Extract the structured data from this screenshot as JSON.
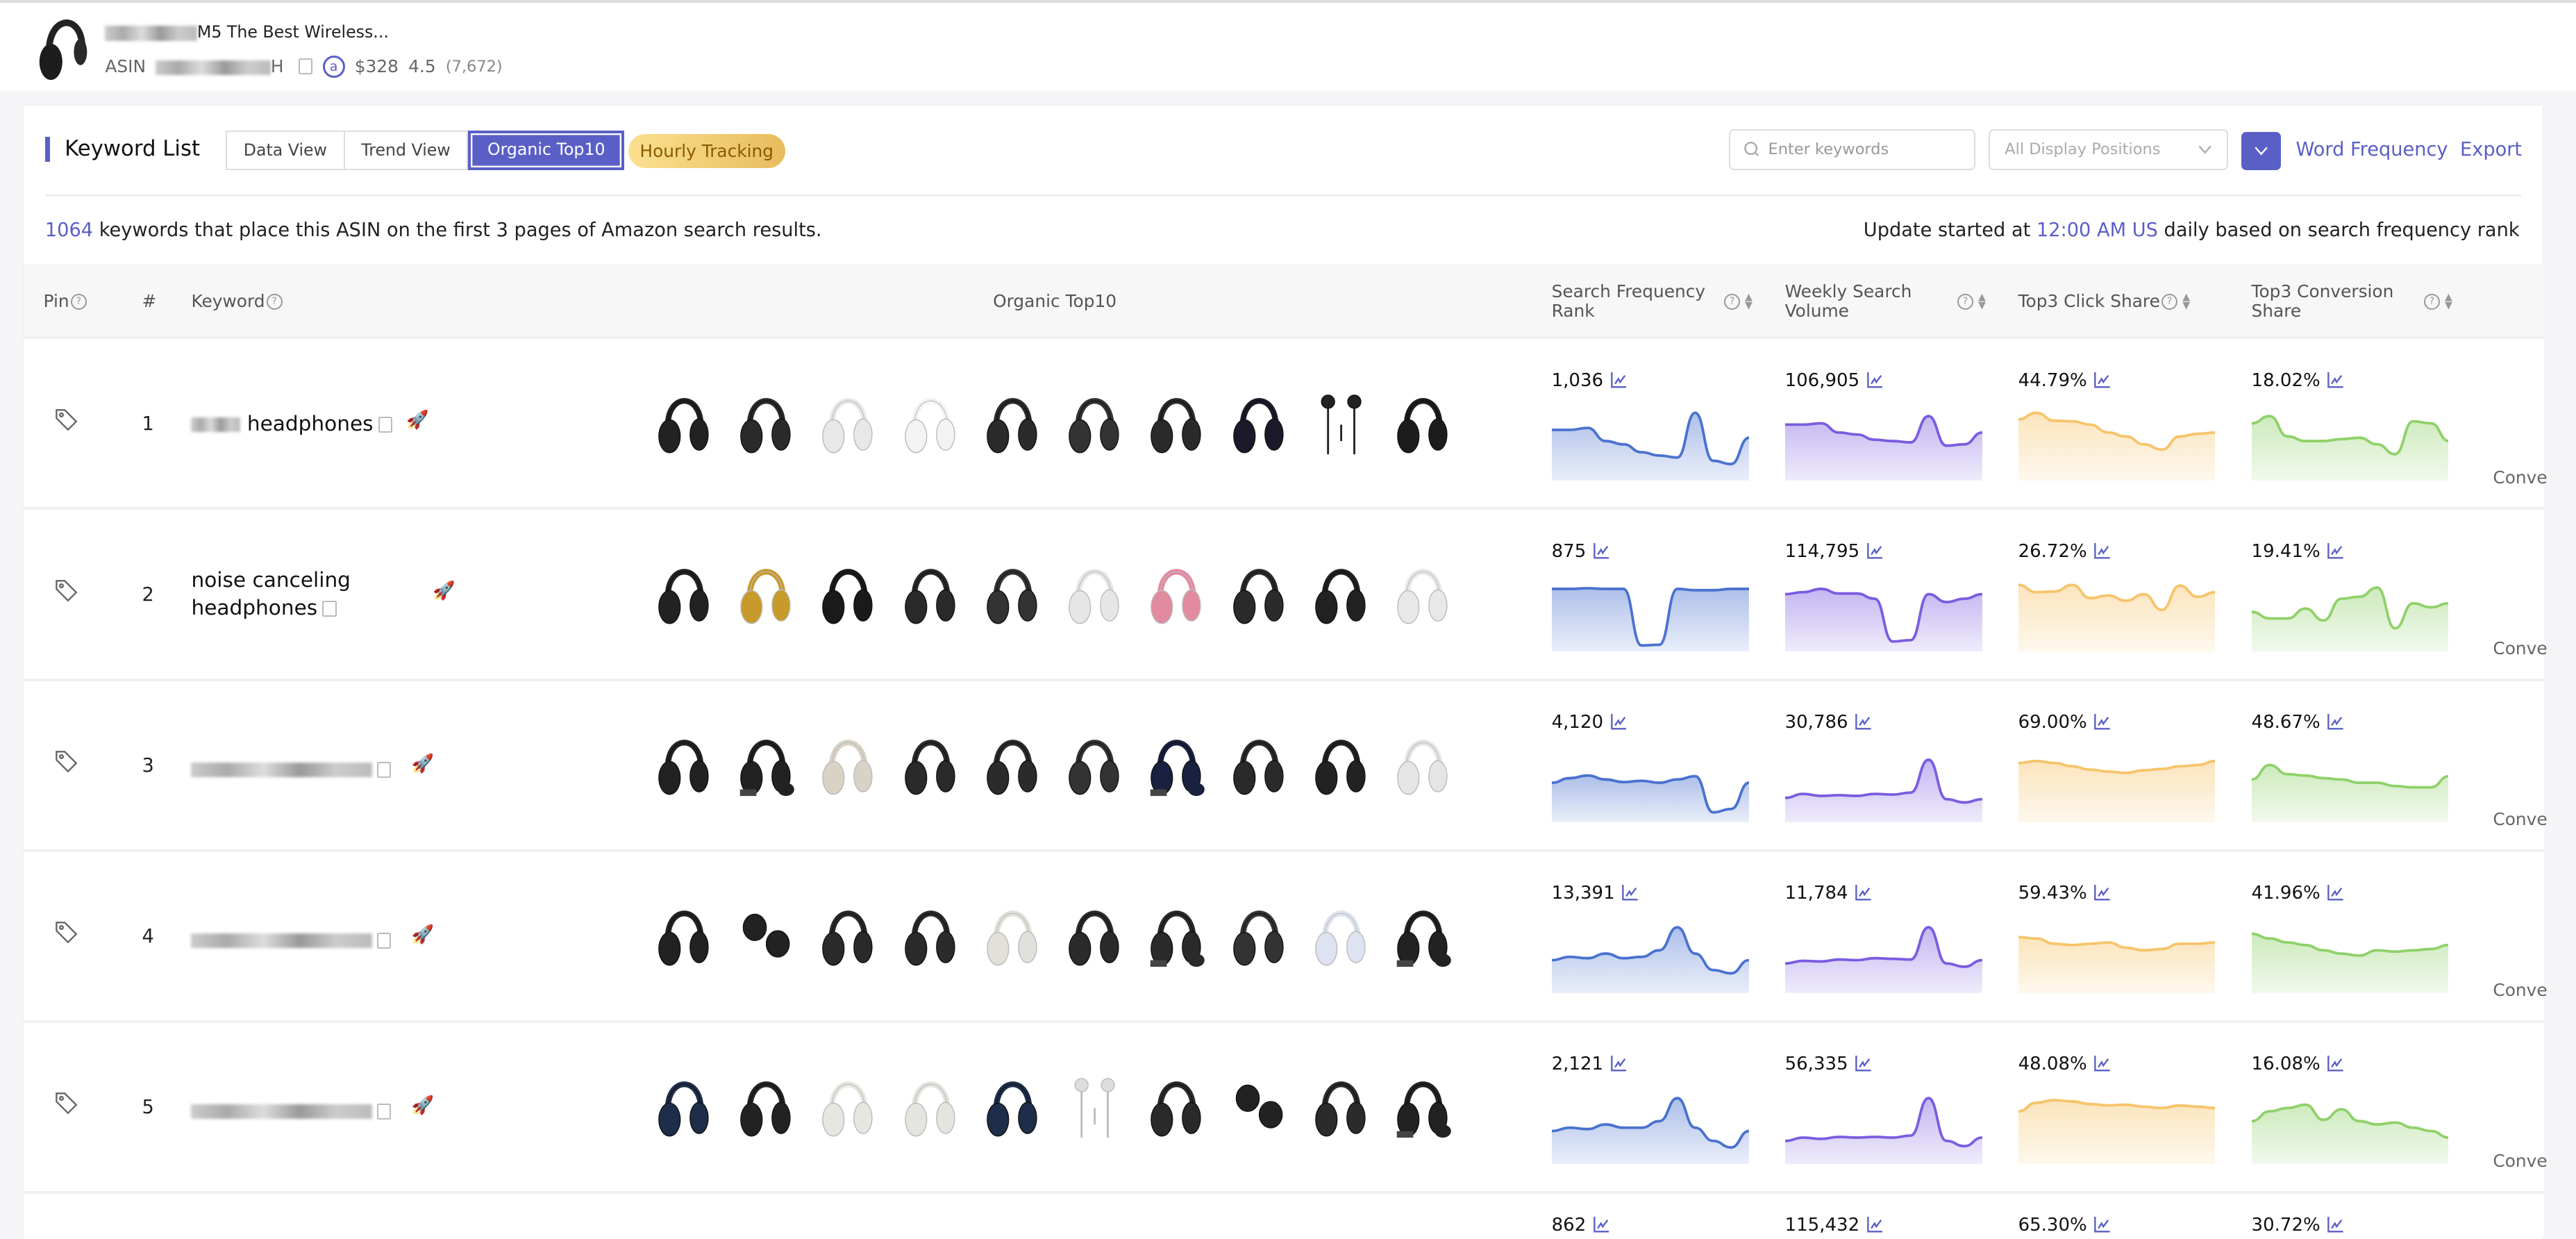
{
  "product": {
    "title_visible": "M5 The Best Wireless...",
    "asin_label": "ASIN",
    "asin_visible_suffix": "H",
    "amazon_icon": "a",
    "price": "$328",
    "rating": "4.5",
    "reviews": "(7,672)"
  },
  "toolbar": {
    "title": "Keyword List",
    "views": [
      {
        "label": "Data View",
        "active": false
      },
      {
        "label": "Trend View",
        "active": false
      },
      {
        "label": "Organic Top10",
        "active": true
      }
    ],
    "hourly_tracking": "Hourly Tracking",
    "search_placeholder": "Enter keywords",
    "position_select": "All Display Positions",
    "word_frequency": "Word Frequency",
    "export": "Export"
  },
  "summary": {
    "count": "1064",
    "text": " keywords that place this ASIN on the first 3 pages of Amazon search results.",
    "update_prefix": "Update started at ",
    "update_time": "12:00 AM US",
    "update_suffix": " daily based on search frequency rank"
  },
  "colors": {
    "accent": "#5a5fc6",
    "sfr": "#4a72cf",
    "volume": "#7b5ce0",
    "click": "#f6c46a",
    "conversion": "#8fd16a"
  },
  "table": {
    "headers": {
      "pin": "Pin",
      "index": "#",
      "keyword": "Keyword",
      "organic": "Organic Top10",
      "sfr": "Search Frequency Rank",
      "volume": "Weekly Search Volume",
      "click": "Top3 Click Share",
      "conversion": "Top3 Conversion Share"
    },
    "overflow_column": "Conve",
    "rows": [
      {
        "index": "1",
        "keyword": "headphones",
        "blurred_prefix": true,
        "blurred": false,
        "sfr": "1,036",
        "volume": "106,905",
        "click": "44.79%",
        "conversion": "18.02%",
        "trends": {
          "sfr": [
            0.72,
            0.72,
            0.75,
            0.55,
            0.5,
            0.38,
            0.33,
            0.3,
            0.98,
            0.25,
            0.2,
            0.6
          ],
          "volume": [
            0.8,
            0.8,
            0.82,
            0.68,
            0.65,
            0.57,
            0.55,
            0.53,
            0.93,
            0.48,
            0.5,
            0.68
          ],
          "click": [
            0.88,
            0.98,
            0.86,
            0.85,
            0.8,
            0.68,
            0.62,
            0.5,
            0.42,
            0.62,
            0.66,
            0.68
          ],
          "conversion": [
            0.82,
            0.93,
            0.62,
            0.55,
            0.55,
            0.58,
            0.6,
            0.5,
            0.35,
            0.85,
            0.82,
            0.55
          ]
        },
        "products": [
          [
            "over-ear",
            "#222"
          ],
          [
            "over-ear",
            "#2a2a2a"
          ],
          [
            "over-ear",
            "#e8e8e8"
          ],
          [
            "over-ear",
            "#f3f3f3"
          ],
          [
            "over-ear",
            "#2b2b2b"
          ],
          [
            "over-ear",
            "#333"
          ],
          [
            "over-ear",
            "#2a2a2a"
          ],
          [
            "over-ear",
            "#1a1a2a"
          ],
          [
            "wired-earbuds",
            "#222"
          ],
          [
            "over-ear",
            "#1c1c1c"
          ]
        ]
      },
      {
        "index": "2",
        "keyword": "noise canceling headphones",
        "blurred_prefix": false,
        "blurred": false,
        "sfr": "875",
        "volume": "114,795",
        "click": "26.72%",
        "conversion": "19.41%",
        "trends": {
          "sfr": [
            0.9,
            0.9,
            0.91,
            0.9,
            0.9,
            0.04,
            0.05,
            0.9,
            0.88,
            0.88,
            0.9,
            0.9
          ],
          "volume": [
            0.82,
            0.85,
            0.9,
            0.83,
            0.83,
            0.75,
            0.1,
            0.12,
            0.82,
            0.7,
            0.75,
            0.82
          ],
          "click": [
            0.96,
            0.85,
            0.86,
            0.96,
            0.76,
            0.8,
            0.72,
            0.82,
            0.58,
            0.95,
            0.78,
            0.85
          ],
          "conversion": [
            0.55,
            0.45,
            0.45,
            0.6,
            0.42,
            0.75,
            0.78,
            0.92,
            0.3,
            0.68,
            0.62,
            0.68
          ]
        },
        "products": [
          [
            "over-ear",
            "#222"
          ],
          [
            "over-ear",
            "#c89a2c"
          ],
          [
            "over-ear",
            "#1a1a1a"
          ],
          [
            "over-ear",
            "#2a2a2a"
          ],
          [
            "over-ear",
            "#333"
          ],
          [
            "over-ear",
            "#e6e6e6"
          ],
          [
            "over-ear",
            "#e28aa0"
          ],
          [
            "over-ear",
            "#2b2b2b"
          ],
          [
            "over-ear",
            "#222"
          ],
          [
            "over-ear",
            "#e8e8e8"
          ]
        ]
      },
      {
        "index": "3",
        "keyword": "",
        "blurred_prefix": false,
        "blurred": true,
        "sfr": "4,120",
        "volume": "30,786",
        "click": "69.00%",
        "conversion": "48.67%",
        "trends": {
          "sfr": [
            0.55,
            0.62,
            0.66,
            0.6,
            0.56,
            0.58,
            0.55,
            0.6,
            0.65,
            0.1,
            0.15,
            0.55
          ],
          "volume": [
            0.32,
            0.38,
            0.35,
            0.36,
            0.35,
            0.38,
            0.37,
            0.4,
            0.9,
            0.3,
            0.25,
            0.3
          ],
          "click": [
            0.85,
            0.88,
            0.85,
            0.8,
            0.75,
            0.72,
            0.7,
            0.74,
            0.76,
            0.8,
            0.82,
            0.88
          ],
          "conversion": [
            0.6,
            0.82,
            0.68,
            0.66,
            0.62,
            0.6,
            0.55,
            0.55,
            0.5,
            0.48,
            0.48,
            0.65
          ]
        },
        "products": [
          [
            "over-ear",
            "#222"
          ],
          [
            "case",
            "#222"
          ],
          [
            "over-ear",
            "#d9d2c5"
          ],
          [
            "over-ear",
            "#2a2a2a"
          ],
          [
            "over-ear",
            "#2b2b2b"
          ],
          [
            "over-ear",
            "#333"
          ],
          [
            "case",
            "#1a2040"
          ],
          [
            "over-ear",
            "#2a2a2a"
          ],
          [
            "over-ear",
            "#222"
          ],
          [
            "over-ear",
            "#e5e5e5"
          ]
        ]
      },
      {
        "index": "4",
        "keyword": "",
        "blurred_prefix": false,
        "blurred": true,
        "sfr": "13,391",
        "volume": "11,784",
        "click": "59.43%",
        "conversion": "41.96%",
        "trends": {
          "sfr": [
            0.45,
            0.5,
            0.48,
            0.55,
            0.48,
            0.5,
            0.6,
            0.95,
            0.55,
            0.3,
            0.25,
            0.45
          ],
          "volume": [
            0.4,
            0.44,
            0.43,
            0.46,
            0.45,
            0.48,
            0.47,
            0.46,
            0.95,
            0.4,
            0.35,
            0.45
          ],
          "click": [
            0.8,
            0.78,
            0.7,
            0.68,
            0.7,
            0.72,
            0.64,
            0.6,
            0.62,
            0.7,
            0.7,
            0.72
          ],
          "conversion": [
            0.85,
            0.78,
            0.72,
            0.68,
            0.6,
            0.55,
            0.52,
            0.6,
            0.58,
            0.6,
            0.62,
            0.68
          ]
        },
        "products": [
          [
            "over-ear",
            "#222"
          ],
          [
            "earbuds",
            "#222"
          ],
          [
            "over-ear",
            "#2a2a2a"
          ],
          [
            "over-ear",
            "#2b2b2b"
          ],
          [
            "over-ear",
            "#e2e0da"
          ],
          [
            "over-ear",
            "#2a2a2a"
          ],
          [
            "case",
            "#2a2a2a"
          ],
          [
            "over-ear",
            "#333"
          ],
          [
            "over-ear",
            "#dde3f0"
          ],
          [
            "case",
            "#222"
          ]
        ]
      },
      {
        "index": "5",
        "keyword": "",
        "blurred_prefix": false,
        "blurred": true,
        "sfr": "2,121",
        "volume": "56,335",
        "click": "48.08%",
        "conversion": "16.08%",
        "trends": {
          "sfr": [
            0.45,
            0.5,
            0.48,
            0.55,
            0.5,
            0.5,
            0.6,
            0.95,
            0.5,
            0.3,
            0.2,
            0.45
          ],
          "volume": [
            0.3,
            0.35,
            0.33,
            0.36,
            0.35,
            0.36,
            0.35,
            0.38,
            0.95,
            0.3,
            0.22,
            0.35
          ],
          "click": [
            0.75,
            0.88,
            0.92,
            0.9,
            0.86,
            0.84,
            0.85,
            0.82,
            0.8,
            0.84,
            0.82,
            0.8
          ],
          "conversion": [
            0.6,
            0.75,
            0.8,
            0.85,
            0.62,
            0.78,
            0.6,
            0.55,
            0.58,
            0.5,
            0.45,
            0.35
          ]
        },
        "products": [
          [
            "over-ear",
            "#1e2e4a"
          ],
          [
            "over-ear",
            "#222"
          ],
          [
            "over-ear",
            "#e8e6e0"
          ],
          [
            "over-ear",
            "#e6e4de"
          ],
          [
            "over-ear",
            "#1e2e4a"
          ],
          [
            "wired-earbuds",
            "#ddd"
          ],
          [
            "over-ear",
            "#2a2a2a"
          ],
          [
            "earbuds",
            "#222"
          ],
          [
            "over-ear",
            "#2b2b2b"
          ],
          [
            "case",
            "#222"
          ]
        ]
      },
      {
        "index": "",
        "keyword": "",
        "blurred_prefix": false,
        "blurred": false,
        "sfr": "862",
        "volume": "115,432",
        "click": "65.30%",
        "conversion": "30.72%",
        "partial": true,
        "products": [],
        "trends": {}
      }
    ]
  }
}
